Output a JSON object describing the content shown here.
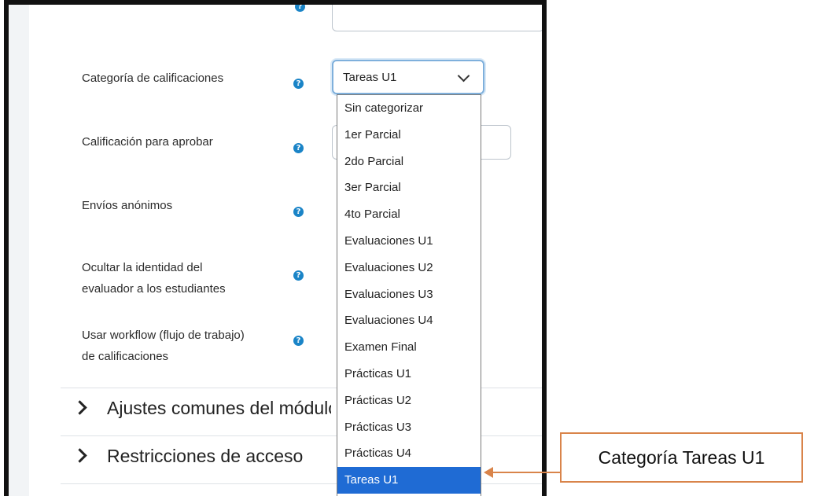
{
  "form": {
    "grade_category_label": "Categoría de calificaciones",
    "grade_to_pass_label": "Calificación para aprobar",
    "anonymous_label": "Envíos anónimos",
    "hide_grader_label_l1": "Ocultar la identidad del",
    "hide_grader_label_l2": "evaluador a los estudiantes",
    "workflow_label_l1": "Usar workflow (flujo de trabajo)",
    "workflow_label_l2": "de calificaciones",
    "help_icon": "?"
  },
  "select": {
    "value": "Tareas U1",
    "options": [
      "Sin categorizar",
      "1er Parcial",
      "2do Parcial",
      "3er Parcial",
      "4to Parcial",
      "Evaluaciones U1",
      "Evaluaciones U2",
      "Evaluaciones U3",
      "Evaluaciones U4",
      "Examen Final",
      "Prácticas U1",
      "Prácticas U2",
      "Prácticas U3",
      "Prácticas U4",
      "Tareas U1"
    ],
    "highlighted": "Tareas U1"
  },
  "sections": {
    "common": "Ajustes comunes del módulo",
    "restrictions": "Restricciones de acceso"
  },
  "callout": {
    "text": "Categoría Tareas U1"
  },
  "colors": {
    "selected_option": "#1f6bd4",
    "help_icon": "#1a84c7",
    "annotation": "#d9844a"
  }
}
